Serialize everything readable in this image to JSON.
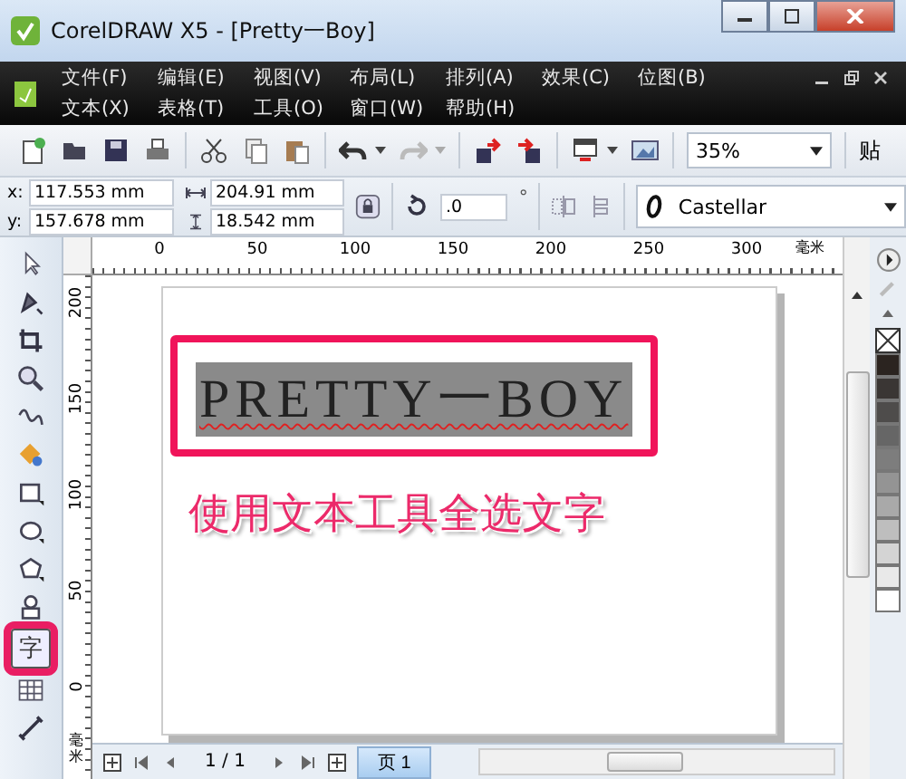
{
  "window": {
    "title": "CorelDRAW X5 - [Pretty一Boy]"
  },
  "menu_rows": [
    [
      {
        "label": "文件(F)"
      },
      {
        "label": "编辑(E)"
      },
      {
        "label": "视图(V)"
      },
      {
        "label": "布局(L)"
      },
      {
        "label": "排列(A)"
      },
      {
        "label": "效果(C)"
      },
      {
        "label": "位图(B)"
      }
    ],
    [
      {
        "label": "文本(X)"
      },
      {
        "label": "表格(T)"
      },
      {
        "label": "工具(O)"
      },
      {
        "label": "窗口(W)"
      },
      {
        "label": "帮助(H)"
      }
    ]
  ],
  "toolbar": {
    "zoom": "35%",
    "cut_label": "贴"
  },
  "property_bar": {
    "x_label": "x:",
    "x": "117.553 mm",
    "y_label": "y:",
    "y": "157.678 mm",
    "width": "204.91 mm",
    "height": "18.542 mm",
    "rotation": ".0",
    "degree": "°",
    "font": "Castellar"
  },
  "toolbox": [
    {
      "kind": "pick",
      "selected": false
    },
    {
      "kind": "shape",
      "selected": false
    },
    {
      "kind": "crop",
      "selected": false
    },
    {
      "kind": "zoom",
      "selected": false
    },
    {
      "kind": "freehand",
      "selected": false
    },
    {
      "kind": "fill",
      "selected": false
    },
    {
      "kind": "rect",
      "selected": false
    },
    {
      "kind": "ellipse",
      "selected": false
    },
    {
      "kind": "polygon",
      "selected": false
    },
    {
      "kind": "basic",
      "selected": false
    },
    {
      "kind": "text",
      "label": "字",
      "selected": true
    },
    {
      "kind": "table",
      "selected": false
    },
    {
      "kind": "connector",
      "selected": false
    }
  ],
  "rulers": {
    "top_ticks": [
      "0",
      "50",
      "100",
      "150",
      "200",
      "250",
      "300"
    ],
    "unit": "毫米",
    "left_ticks": [
      "200",
      "150",
      "100",
      "50",
      "0"
    ],
    "left_unit": "毫米"
  },
  "canvas": {
    "text": "PRETTY一BOY",
    "text_selected": true,
    "caption": "使用文本工具全选文字"
  },
  "palette": [
    {
      "color": "#2b2420"
    },
    {
      "color": "#3a3634"
    },
    {
      "color": "#4e4c4b"
    },
    {
      "color": "#666666"
    },
    {
      "color": "#7d7d7d"
    },
    {
      "color": "#949494"
    },
    {
      "color": "#a9a9a9"
    },
    {
      "color": "#bebebe"
    },
    {
      "color": "#d4d4d4"
    },
    {
      "color": "#e9e9e9"
    },
    {
      "color": "#ffffff"
    }
  ],
  "page_nav": {
    "counter": "1 / 1",
    "tab": "页 1"
  }
}
